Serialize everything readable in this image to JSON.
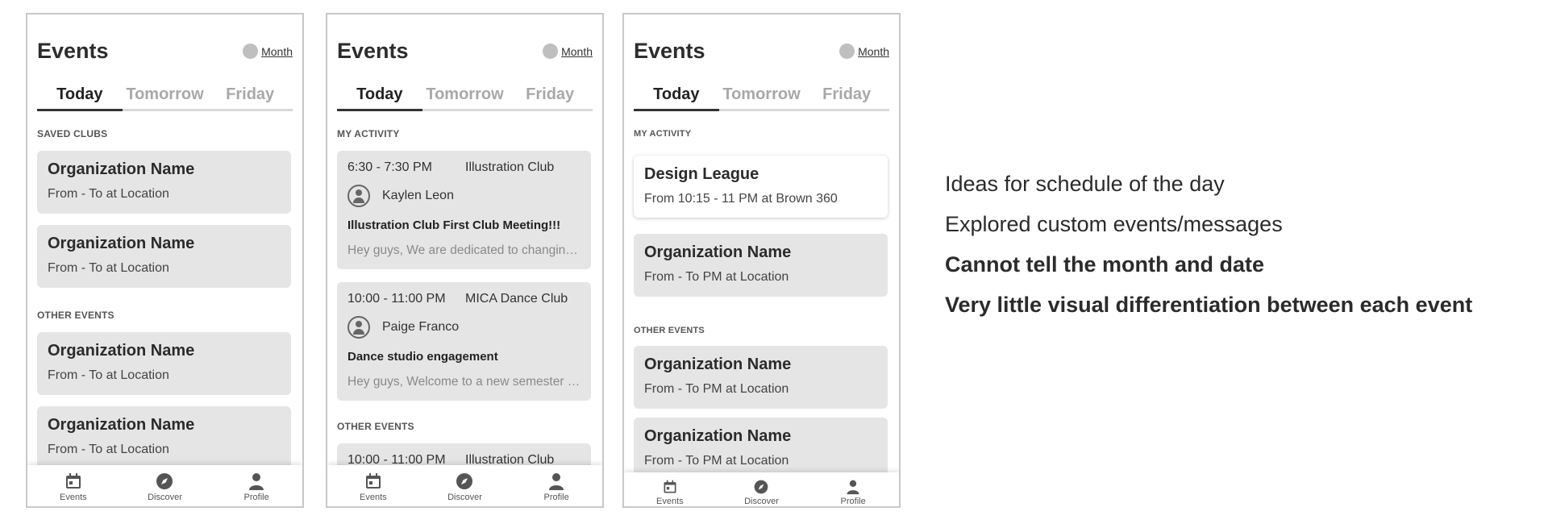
{
  "phones": [
    {
      "title": "Events",
      "month_label": "Month",
      "tabs": [
        "Today",
        "Tomorrow",
        "Friday"
      ],
      "sections": [
        "SAVED CLUBS",
        "OTHER EVENTS"
      ],
      "cards": [
        {
          "name": "Organization Name",
          "meta": "From - To at Location"
        },
        {
          "name": "Organization Name",
          "meta": "From - To at Location"
        },
        {
          "name": "Organization Name",
          "meta": "From - To at Location"
        },
        {
          "name": "Organization Name",
          "meta": "From - To at Location"
        }
      ],
      "nav": [
        "Events",
        "Discover",
        "Profile"
      ]
    },
    {
      "title": "Events",
      "month_label": "Month",
      "tabs": [
        "Today",
        "Tomorrow",
        "Friday"
      ],
      "sections": [
        "MY ACTIVITY",
        "OTHER EVENTS"
      ],
      "activities": [
        {
          "time": "6:30 - 7:30 PM",
          "club": "Illustration Club",
          "person": "Kaylen Leon",
          "title": "Illustration Club First Club Meeting!!!",
          "body": "Hey guys, We are dedicated to changing the way"
        },
        {
          "time": "10:00 - 11:00 PM",
          "club": "MICA Dance Club",
          "person": "Paige Franco",
          "title": "Dance studio engagement",
          "body": "Hey guys, Welcome to a new semester of dance"
        },
        {
          "time": "10:00 - 11:00 PM",
          "club": "Illustration Club"
        }
      ],
      "nav": [
        "Events",
        "Discover",
        "Profile"
      ]
    },
    {
      "title": "Events",
      "month_label": "Month",
      "tabs": [
        "Today",
        "Tomorrow",
        "Friday"
      ],
      "sections": [
        "MY ACTIVITY",
        "OTHER EVENTS"
      ],
      "featured": {
        "name": "Design League",
        "meta": "From 10:15 - 11 PM at Brown 360"
      },
      "cards": [
        {
          "name": "Organization Name",
          "meta": "From - To PM at Location"
        },
        {
          "name": "Organization Name",
          "meta": "From - To PM at Location"
        },
        {
          "name": "Organization Name",
          "meta": "From - To PM at Location"
        }
      ],
      "nav": [
        "Events",
        "Discover",
        "Profile"
      ]
    }
  ],
  "notes": [
    "Ideas for schedule of the day",
    "Explored custom events/messages",
    "Cannot tell the month and date",
    "Very little visual differentiation between each event"
  ],
  "colors": {
    "card_gray": "#e5e5e5",
    "border": "#c8c8c8",
    "inactive_tab": "#a8a8a8"
  }
}
